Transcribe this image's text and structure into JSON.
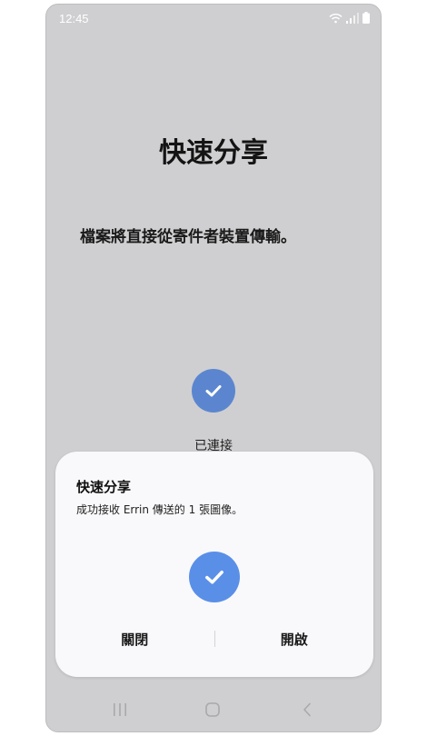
{
  "status_bar": {
    "time": "12:45",
    "icons": [
      "wifi-icon",
      "signal-icon",
      "battery-icon"
    ]
  },
  "main": {
    "title": "快速分享",
    "description": "檔案將直接從寄件者裝置傳輸。",
    "connected_label": "已連接",
    "check_icon": "check-icon"
  },
  "dialog": {
    "title": "快速分享",
    "message": "成功接收 Errin 傳送的 1 張圖像。",
    "check_icon": "check-icon",
    "close_label": "關閉",
    "open_label": "開啟"
  },
  "nav_bar": {
    "icons": [
      "recents-icon",
      "home-icon",
      "back-icon"
    ]
  },
  "colors": {
    "background": "#cfcfd1",
    "dialog_background": "#f9f9fb",
    "accent_check_connected": "#5b86cf",
    "accent_check_dialog": "#5a8fe8"
  }
}
